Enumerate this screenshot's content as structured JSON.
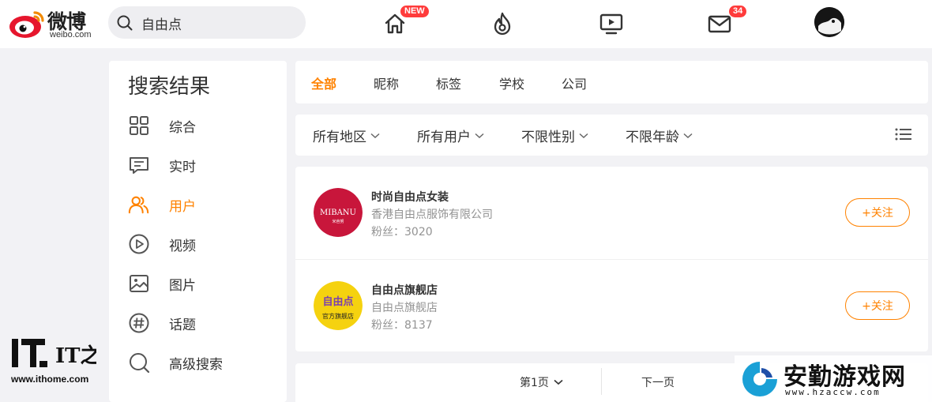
{
  "header": {
    "logo_text": "微博",
    "logo_domain": "weibo.com",
    "search_value": "自由点",
    "nav": [
      {
        "icon": "home-icon",
        "badge": "NEW"
      },
      {
        "icon": "hot-flame-icon",
        "badge": ""
      },
      {
        "icon": "video-tv-icon",
        "badge": ""
      },
      {
        "icon": "mail-icon",
        "badge": "34"
      },
      {
        "icon": "user-avatar",
        "badge": ""
      }
    ]
  },
  "sidebar": {
    "title": "搜索结果",
    "items": [
      {
        "label": "综合",
        "icon": "grid-icon",
        "active": false
      },
      {
        "label": "实时",
        "icon": "message-icon",
        "active": false
      },
      {
        "label": "用户",
        "icon": "users-icon",
        "active": true
      },
      {
        "label": "视频",
        "icon": "play-icon",
        "active": false
      },
      {
        "label": "图片",
        "icon": "image-icon",
        "active": false
      },
      {
        "label": "话题",
        "icon": "hashtag-icon",
        "active": false
      },
      {
        "label": "高级搜索",
        "icon": "search-icon",
        "active": false
      }
    ]
  },
  "tabs": [
    {
      "label": "全部",
      "active": true
    },
    {
      "label": "昵称",
      "active": false
    },
    {
      "label": "标签",
      "active": false
    },
    {
      "label": "学校",
      "active": false
    },
    {
      "label": "公司",
      "active": false
    }
  ],
  "filters": [
    {
      "label": "所有地区"
    },
    {
      "label": "所有用户"
    },
    {
      "label": "不限性别"
    },
    {
      "label": "不限年龄"
    }
  ],
  "results": [
    {
      "name": "时尚自由点女装",
      "desc": "香港自由点服饰有限公司",
      "fans": "粉丝：3020",
      "follow": "+关注",
      "avatar_text": "MIBANU",
      "avatar_sub": "米芭努",
      "avatar_color": "#c8163b"
    },
    {
      "name": "自由点旗舰店",
      "desc": "自由点旗舰店",
      "fans": "粉丝：8137",
      "follow": "+关注",
      "avatar_text": "自由点",
      "avatar_sub": "官方旗舰店",
      "avatar_color": "#f5d20f"
    }
  ],
  "pager": {
    "current": "第1页",
    "next": "下一页"
  },
  "watermarks": {
    "it": "IT之家",
    "it_url": "www.ithome.com",
    "hz": "安勤游戏网",
    "hz_url": "www.hzaccw.com"
  },
  "colors": {
    "accent": "#ff8200",
    "badge": "#ff3b3b",
    "muted": "#939393"
  }
}
